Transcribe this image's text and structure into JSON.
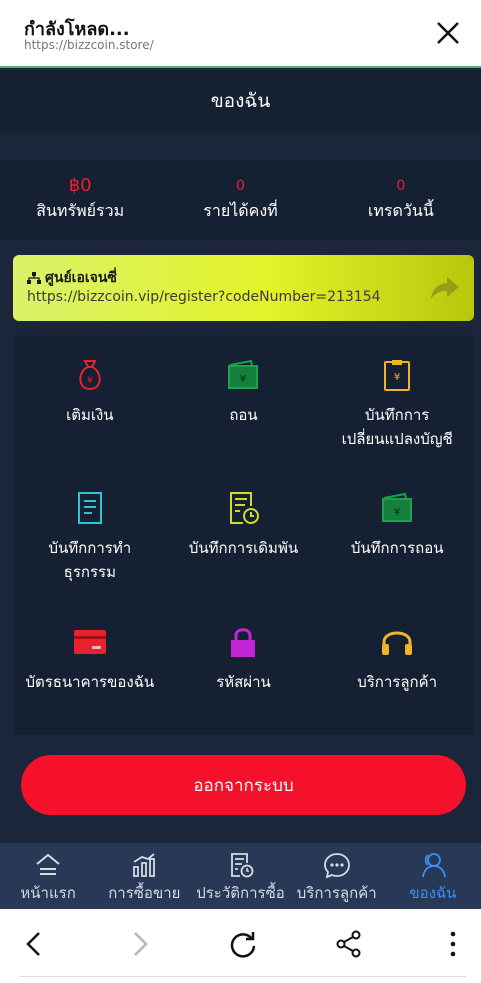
{
  "browser": {
    "title": "กำลังโหลด...",
    "url": "https://bizzcoin.store/"
  },
  "header": {
    "title": "ของฉัน"
  },
  "stats": [
    {
      "value": "฿0",
      "label": "สินทรัพย์รวม"
    },
    {
      "value": "0",
      "label": "รายได้คงที่"
    },
    {
      "value": "0",
      "label": "เทรดวันนี้"
    }
  ],
  "agent": {
    "title": "ศูนย์เอเจนซี่",
    "link": "https://bizzcoin.vip/register?codeNumber=213154"
  },
  "grid": [
    {
      "label": "เติมเงิน",
      "icon": "money-bag-icon",
      "color": "#e8212f"
    },
    {
      "label": "ถอน",
      "icon": "wallet-icon",
      "color": "#16a34a"
    },
    {
      "label": "บันทึกการ\nเปลี่ยนแปลงบัญชี",
      "icon": "clipboard-icon",
      "color": "#f0b429"
    },
    {
      "label": "บันทึกการทำ\nธุรกรรม",
      "icon": "document-icon",
      "color": "#2ec4d6"
    },
    {
      "label": "บันทึกการเดิมพัน",
      "icon": "document-clock-icon",
      "color": "#d4d92a"
    },
    {
      "label": "บันทึกการถอน",
      "icon": "wallet-icon",
      "color": "#16a34a"
    },
    {
      "label": "บัตรธนาคารของฉัน",
      "icon": "card-icon",
      "color": "#e8212f"
    },
    {
      "label": "รหัสผ่าน",
      "icon": "lock-icon",
      "color": "#c026d3"
    },
    {
      "label": "บริการลูกค้า",
      "icon": "headphones-icon",
      "color": "#f0b429"
    }
  ],
  "logout": {
    "label": "ออกจากระบบ"
  },
  "nav": [
    {
      "label": "หน้าแรก",
      "icon": "home-icon"
    },
    {
      "label": "การซื้อขาย",
      "icon": "chart-icon"
    },
    {
      "label": "ประวัติการซื้อ",
      "icon": "history-icon"
    },
    {
      "label": "บริการลูกค้า",
      "icon": "chat-icon"
    },
    {
      "label": "ของฉัน",
      "icon": "user-icon",
      "active": true
    }
  ]
}
